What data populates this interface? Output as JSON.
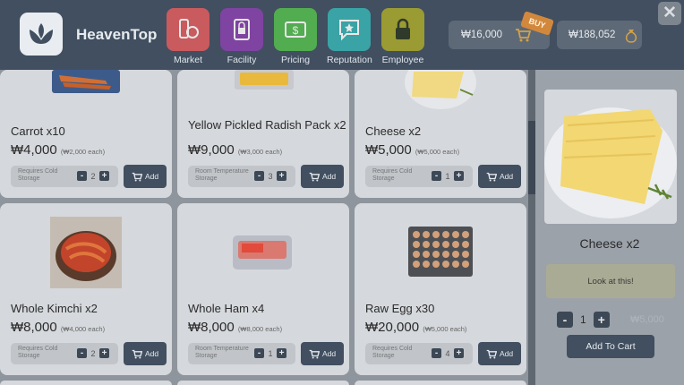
{
  "app": {
    "name": "HeavenTop"
  },
  "nav": [
    {
      "label": "Market",
      "icon": "market-icon",
      "color": "#c95a5e"
    },
    {
      "label": "Facility",
      "icon": "facility-icon",
      "color": "#7f43a1"
    },
    {
      "label": "Pricing",
      "icon": "pricing-icon",
      "color": "#52ac50"
    },
    {
      "label": "Reputation",
      "icon": "reputation-icon",
      "color": "#3aa3a5"
    },
    {
      "label": "Employee",
      "icon": "employee-icon",
      "color": "#9a9b32"
    }
  ],
  "wallet": {
    "cart_total": "₩16,000",
    "buy_tag": "BUY",
    "balance": "₩188,052"
  },
  "products": [
    {
      "name": "Carrot x10",
      "price": "₩4,000",
      "each": "(₩2,000 each)",
      "storage": "Requires Cold Storage",
      "qty": "2",
      "add": "Add"
    },
    {
      "name": "Yellow Pickled Radish Pack x2",
      "price": "₩9,000",
      "each": "(₩3,000 each)",
      "storage": "Room Temperature Storage",
      "qty": "3",
      "add": "Add"
    },
    {
      "name": "Cheese x2",
      "price": "₩5,000",
      "each": "(₩5,000 each)",
      "storage": "Requires Cold Storage",
      "qty": "1",
      "add": "Add"
    },
    {
      "name": "Whole Kimchi x2",
      "price": "₩8,000",
      "each": "(₩4,000 each)",
      "storage": "Requires Cold Storage",
      "qty": "2",
      "add": "Add"
    },
    {
      "name": "Whole Ham x4",
      "price": "₩8,000",
      "each": "(₩8,000 each)",
      "storage": "Room Temperature Storage",
      "qty": "1",
      "add": "Add"
    },
    {
      "name": "Raw Egg x30",
      "price": "₩20,000",
      "each": "(₩5,000 each)",
      "storage": "Requires Cold Storage",
      "qty": "4",
      "add": "Add"
    }
  ],
  "detail": {
    "title": "Cheese x2",
    "note": "Look at this!",
    "qty": "1",
    "ghost_price": "₩5,000",
    "cart_button": "Add To Cart"
  },
  "colors": {
    "header": "#414f60",
    "accent_orange": "#d2883c",
    "card": "#d5d8dc"
  }
}
